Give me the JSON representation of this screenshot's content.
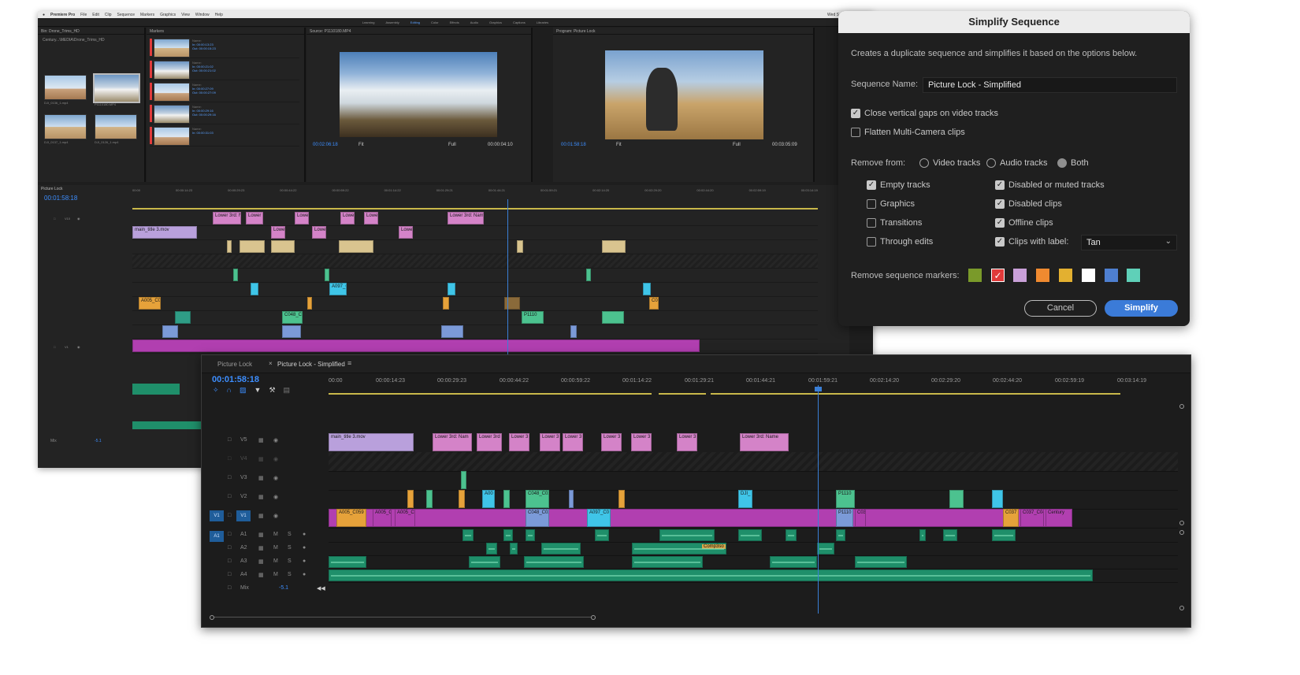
{
  "menu": {
    "app": "Premiere Pro",
    "items": [
      "File",
      "Edit",
      "Clip",
      "Sequence",
      "Markers",
      "Graphics",
      "View",
      "Window",
      "Help"
    ],
    "clock": "Wed Sep 22 12:16 AM"
  },
  "workspaces": {
    "items": [
      "Learning",
      "Assembly",
      "Editing",
      "Color",
      "Effects",
      "Audio",
      "Graphics",
      "Captions",
      "Libraries"
    ],
    "active_index": 2
  },
  "bin": {
    "title": "Bin: Drone_Trims_HD",
    "path": "Century...\\MEDIA\\Drone_Trims_HD",
    "items": [
      {
        "name": "DJI_0136_1.mp4",
        "dur": "2:22"
      },
      {
        "name": "P1110180.MP4",
        "dur": "4:16"
      },
      {
        "name": "DJI_0137_1.mp4",
        "dur": "6:15"
      },
      {
        "name": "DJI_0126_1.mp4",
        "dur": "2:44"
      }
    ]
  },
  "markers_panel": {
    "title": "Markers",
    "rows": [
      {
        "name": "Name:",
        "in": "In: 00:00:13:23",
        "out": "Out: 00:00:15:23"
      },
      {
        "name": "Name:",
        "in": "In: 00:00:21:02",
        "out": "Out: 00:00:21:02"
      },
      {
        "name": "Name:",
        "in": "In: 00:00:27:09",
        "out": "Out: 00:00:27:09"
      },
      {
        "name": "Name:",
        "in": "In: 00:00:29:16",
        "out": "Out: 00:00:29:16"
      },
      {
        "name": "Name:",
        "in": "In: 00:00:31:03",
        "out": ""
      }
    ]
  },
  "source_monitor": {
    "title": "Source: P1110180.MP4",
    "tc_left": "00:02:06:18",
    "fit": "Fit",
    "quality": "Full",
    "tc_right": "00:00:04:10"
  },
  "program_monitor": {
    "title": "Program: Picture Lock",
    "tc_left": "00:01:58:18",
    "fit": "Fit",
    "quality": "Full",
    "tc_right": "00:03:05:09"
  },
  "old_timeline": {
    "tab": "Picture Lock",
    "timecode": "00:01:58:18",
    "ruler": [
      "00:00",
      "00:00:14:23",
      "00:00:29:23",
      "00:00:44:22",
      "00:00:59:22",
      "00:01:14:22",
      "00:01:29:21",
      "00:01:44:21",
      "00:01:59:21",
      "00:02:14:20",
      "00:02:29:20",
      "00:02:44:20",
      "00:02:59:19",
      "00:03:14:19"
    ],
    "tracks": [
      "V10",
      "V9",
      "V8",
      "V7",
      "V6",
      "V5",
      "V4",
      "V3",
      "V2",
      "V1",
      "A1",
      "A2",
      "A3",
      "A4",
      "A5",
      "A6",
      "A7",
      "Mix"
    ],
    "mix_value": "-5.1",
    "clip_labels": [
      "Lower 3rd: Nam",
      "Lower 3rd",
      "Lower 3",
      "Lower 3rd: Name",
      "main_title 3.mov",
      "A005_C059",
      "A097_C0",
      "C048_C02",
      "P1110",
      "C037"
    ]
  },
  "dialog": {
    "title": "Simplify Sequence",
    "description": "Creates a duplicate sequence and simplifies it based on the options below.",
    "sequence_name_label": "Sequence Name:",
    "sequence_name_value": "Picture Lock - Simplified",
    "close_gaps": {
      "label": "Close vertical gaps on video tracks",
      "checked": true
    },
    "flatten_multicam": {
      "label": "Flatten Multi-Camera clips",
      "checked": false
    },
    "remove_from_label": "Remove from:",
    "remove_from_options": [
      "Video tracks",
      "Audio tracks",
      "Both"
    ],
    "remove_from_selected": "Both",
    "left_options": [
      {
        "label": "Empty tracks",
        "checked": true
      },
      {
        "label": "Graphics",
        "checked": false
      },
      {
        "label": "Transitions",
        "checked": false
      },
      {
        "label": "Through edits",
        "checked": false
      }
    ],
    "right_options": [
      {
        "label": "Disabled or muted tracks",
        "checked": true
      },
      {
        "label": "Disabled clips",
        "checked": true
      },
      {
        "label": "Offline clips",
        "checked": true
      },
      {
        "label": "Clips with label:",
        "checked": true
      }
    ],
    "label_dropdown_value": "Tan",
    "remove_markers_label": "Remove sequence markers:",
    "marker_colors": [
      "#7a9a2a",
      "#e03a3a",
      "#c9a0d8",
      "#f08a30",
      "#e3b030",
      "#ffffff",
      "#4e7fd0",
      "#5fd0b8"
    ],
    "marker_selected_index": 1,
    "cancel_label": "Cancel",
    "simplify_label": "Simplify"
  },
  "new_timeline": {
    "tabs": [
      "Picture Lock",
      "Picture Lock - Simplified"
    ],
    "active_tab": 1,
    "timecode": "00:01:58:18",
    "ruler": [
      "00:00",
      "00:00:14:23",
      "00:00:29:23",
      "00:00:44:22",
      "00:00:59:22",
      "00:01:14:22",
      "00:01:29:21",
      "00:01:44:21",
      "00:01:59:21",
      "00:02:14:20",
      "00:02:29:20",
      "00:02:44:20",
      "00:02:59:19",
      "00:03:14:19"
    ],
    "video_tracks": [
      "V5",
      "V4",
      "V3",
      "V2",
      "V1"
    ],
    "audio_tracks": [
      "A1",
      "A2",
      "A3",
      "A4"
    ],
    "mix_label": "Mix",
    "mix_value": "-5.1",
    "source_patch_v": "V1",
    "source_patch_a": "A1",
    "v5_clips": [
      "main_title 3.mov",
      "Lower 3rd: Nam",
      "Lower 3rd",
      "Lower 3",
      "Lower 3",
      "Lower 3",
      "Lower 3",
      "Lower 3",
      "Lower 3",
      "Lower 3rd: Name"
    ],
    "v1_labels": [
      "A005_C059",
      "A005_C",
      "A005_C",
      "C048_C02",
      "A097_C0",
      "P1110",
      "C03",
      "C037",
      "C037_C04",
      "Century"
    ],
    "v2_labels": [
      "A00",
      "C048_C02",
      "DJI_",
      "P1110"
    ],
    "a2_label": "Comp3so"
  }
}
